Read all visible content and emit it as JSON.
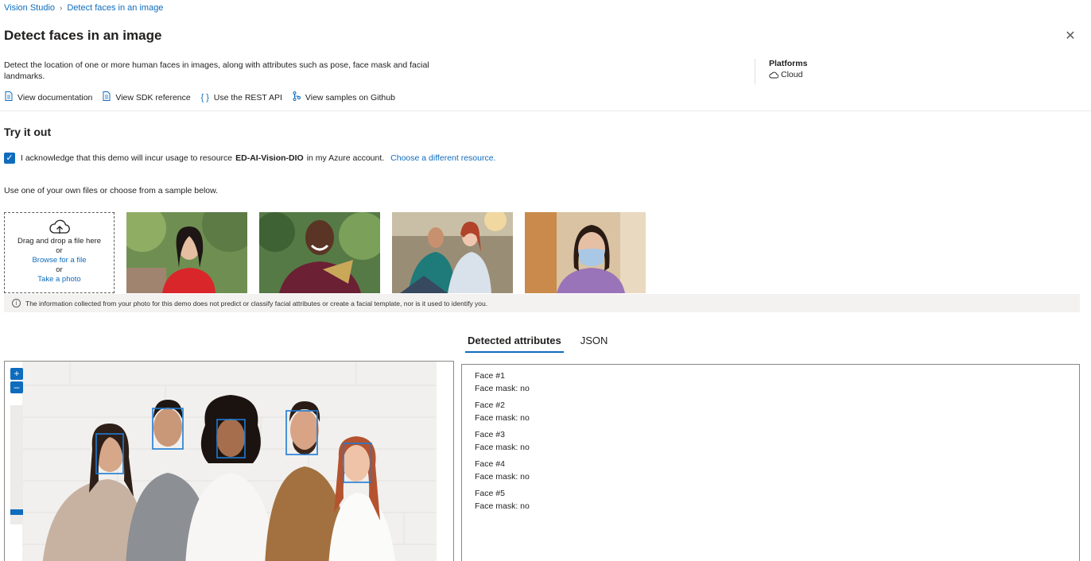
{
  "breadcrumb": {
    "root": "Vision Studio",
    "current": "Detect faces in an image"
  },
  "title": "Detect faces in an image",
  "description": "Detect the location of one or more human faces in images, along with attributes such as pose, face mask and facial landmarks.",
  "platforms": {
    "title": "Platforms",
    "value": "Cloud"
  },
  "links": [
    {
      "label": "View documentation",
      "icon": "document-icon"
    },
    {
      "label": "View SDK reference",
      "icon": "document-icon"
    },
    {
      "label": "Use the REST API",
      "icon": "braces-icon"
    },
    {
      "label": "View samples on Github",
      "icon": "branch-icon"
    }
  ],
  "try_it": {
    "title": "Try it out",
    "ack_prefix": "I acknowledge that this demo will incur usage to resource",
    "ack_resource": "ED-AI-Vision-DIO",
    "ack_suffix": "in my Azure account.",
    "change_resource": "Choose a different resource.",
    "instruction": "Use one of your own files or choose from a sample below."
  },
  "upload": {
    "drag_text": "Drag and drop a file here",
    "or1": "or",
    "browse": "Browse for a file",
    "or2": "or",
    "photo": "Take a photo"
  },
  "info_text": "The information collected from your photo for this demo does not predict or classify facial attributes or create a facial template, nor is it used to identify you.",
  "tabs": {
    "active": "Detected attributes",
    "inactive": "JSON"
  },
  "zoom": {
    "in": "+",
    "out": "–"
  },
  "results": [
    {
      "face": "Face #1",
      "mask": "Face mask: no"
    },
    {
      "face": "Face #2",
      "mask": "Face mask: no"
    },
    {
      "face": "Face #3",
      "mask": "Face mask: no"
    },
    {
      "face": "Face #4",
      "mask": "Face mask: no"
    },
    {
      "face": "Face #5",
      "mask": "Face mask: no"
    }
  ],
  "colors": {
    "accent": "#0f6cbd",
    "face_box": "#1f7ad4"
  }
}
